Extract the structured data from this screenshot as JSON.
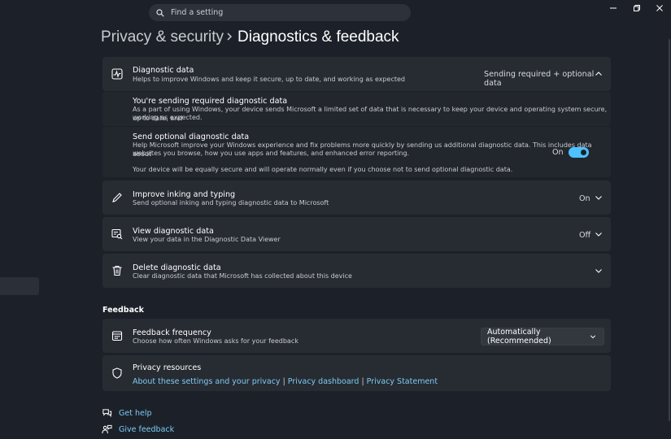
{
  "search": {
    "placeholder": "Find a setting"
  },
  "breadcrumb": {
    "parent": "Privacy & security",
    "current": "Diagnostics & feedback"
  },
  "diagnostic_data": {
    "title": "Diagnostic data",
    "subtitle": "Helps to improve Windows and keep it secure, up to date, and working as expected",
    "value": "Sending required + optional data",
    "required": {
      "title": "You're sending required diagnostic data",
      "line1": "As a part of using Windows, your device sends Microsoft a limited set of data that is necessary to keep your device and operating system secure, up to date, and",
      "line2": "working as expected."
    },
    "optional": {
      "title": "Send optional diagnostic data",
      "line1": "Help Microsoft improve your Windows experience and fix problems more quickly by sending us additional diagnostic data. This includes data about",
      "line2": "websites you browse, how you use apps and features, and enhanced error reporting.",
      "note": "Your device will be equally secure and will operate normally even if you choose not to send optional diagnostic data.",
      "toggle_label": "On",
      "toggle_on": true
    }
  },
  "inking": {
    "title": "Improve inking and typing",
    "subtitle": "Send optional inking and typing diagnostic data to Microsoft",
    "value": "On"
  },
  "view_diag": {
    "title": "View diagnostic data",
    "subtitle": "View your data in the Diagnostic Data Viewer",
    "value": "Off"
  },
  "delete_diag": {
    "title": "Delete diagnostic data",
    "subtitle": "Clear diagnostic data that Microsoft has collected about this device"
  },
  "feedback_section": "Feedback",
  "feedback_frequency": {
    "title": "Feedback frequency",
    "subtitle": "Choose how often Windows asks for your feedback",
    "selected": "Automatically (Recommended)"
  },
  "privacy_resources": {
    "title": "Privacy resources",
    "links": [
      "About these settings and your privacy",
      "Privacy dashboard",
      "Privacy Statement"
    ],
    "separator": "|"
  },
  "bottom_links": {
    "help": "Get help",
    "feedback": "Give feedback"
  },
  "colors": {
    "accent": "#4cc2ff",
    "link": "#7ecbf2",
    "background": "#1c2129",
    "card": "#272b32"
  },
  "icons": {
    "search": "search-icon",
    "diagnostic": "pulse-chart-icon",
    "inking": "pen-icon",
    "view": "diagnostic-viewer-icon",
    "delete": "trash-icon",
    "frequency": "calendar-icon",
    "privacy": "shield-icon",
    "help": "help-chat-icon",
    "feedback": "feedback-person-icon"
  }
}
